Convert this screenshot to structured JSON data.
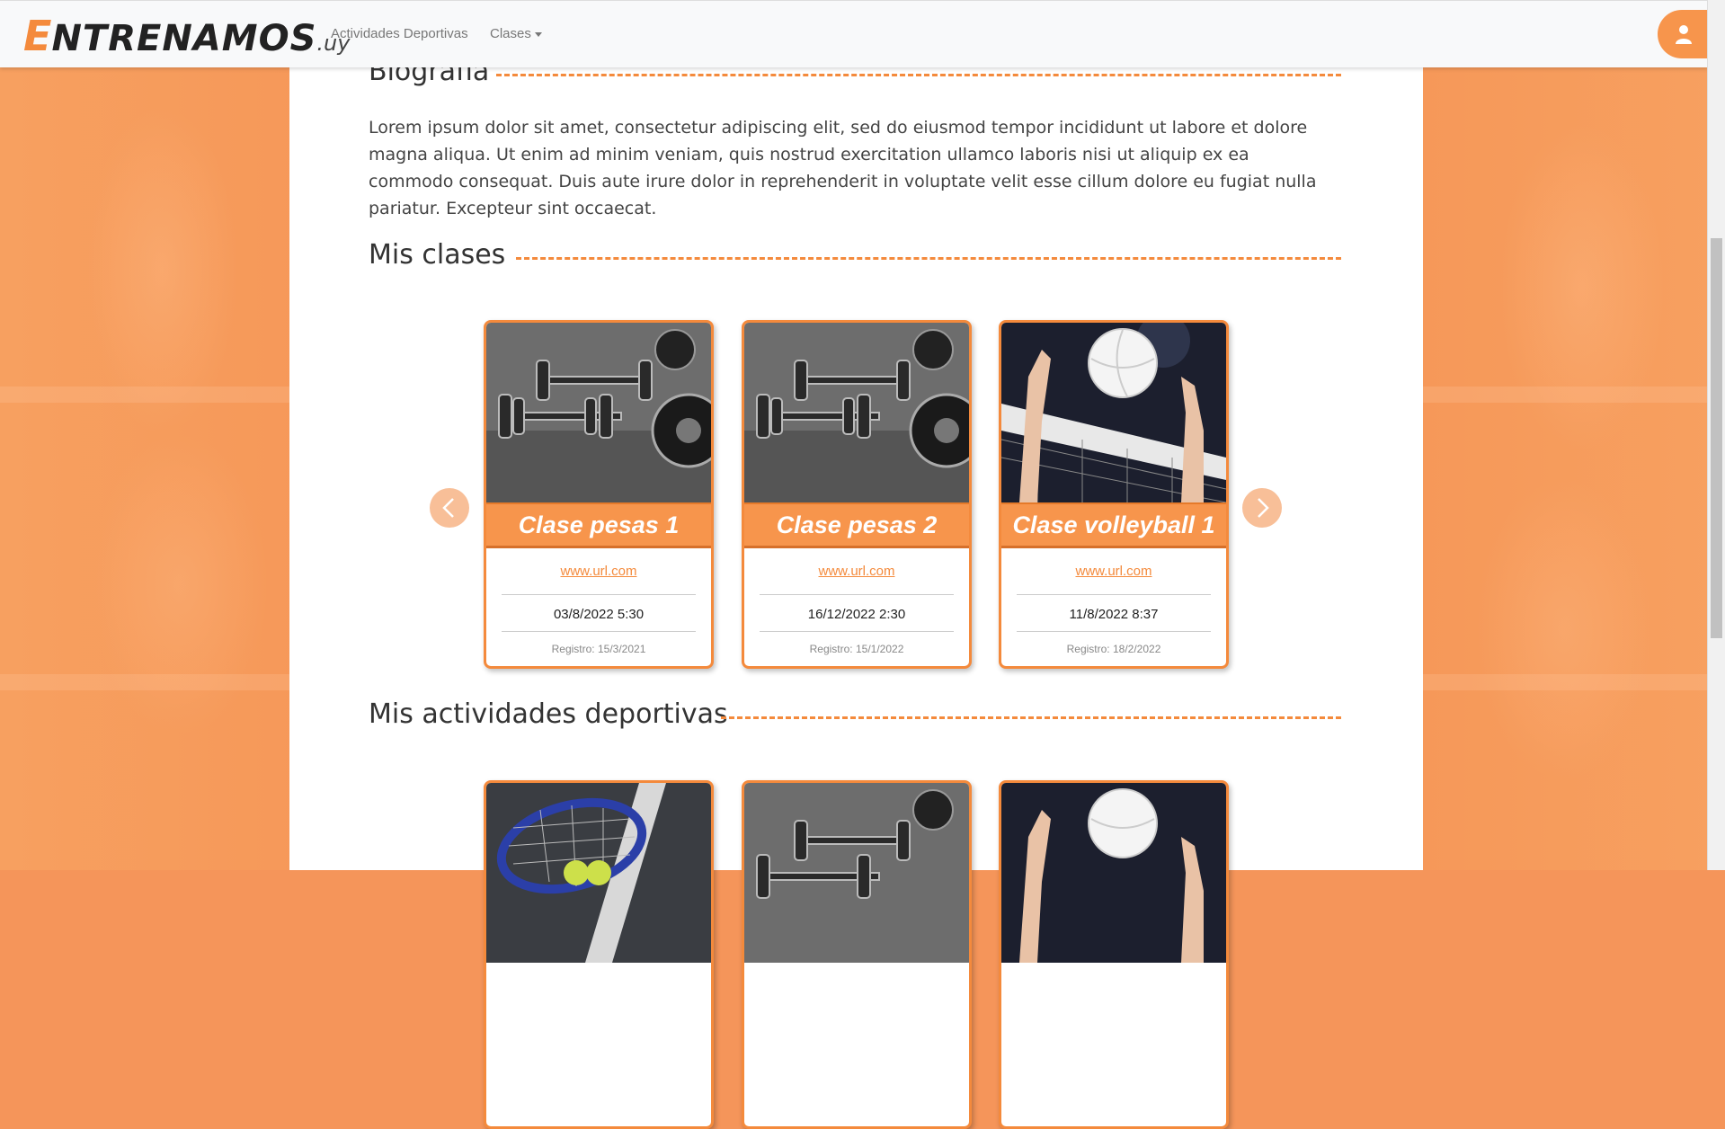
{
  "navbar": {
    "brand_e": "E",
    "brand_rest": "NTRENAMOS",
    "brand_uy": ".uy",
    "links": [
      {
        "label": "Actividades Deportivas"
      },
      {
        "label": "Clases"
      }
    ],
    "user_icon": "user-icon"
  },
  "biography": {
    "title": "Biografía",
    "text": "Lorem ipsum dolor sit amet, consectetur adipiscing elit, sed do eiusmod tempor incididunt ut labore et dolore magna aliqua. Ut enim ad minim veniam, quis nostrud exercitation ullamco laboris nisi ut aliquip ex ea commodo consequat. Duis aute irure dolor in reprehenderit in voluptate velit esse cillum dolore eu fugiat nulla pariatur. Excepteur sint occaecat."
  },
  "classes": {
    "title": "Mis clases",
    "items": [
      {
        "name": "Clase pesas 1",
        "url": "www.url.com",
        "date": "03/8/2022 5:30",
        "registro": "Registro: 15/3/2021",
        "image": "dumbbells"
      },
      {
        "name": "Clase pesas 2",
        "url": "www.url.com",
        "date": "16/12/2022 2:30",
        "registro": "Registro: 15/1/2022",
        "image": "dumbbells"
      },
      {
        "name": "Clase volleyball 1",
        "url": "www.url.com",
        "date": "11/8/2022 8:37",
        "registro": "Registro: 18/2/2022",
        "image": "volleyball"
      }
    ],
    "prev_icon": "chevron-left-icon",
    "next_icon": "chevron-right-icon"
  },
  "activities": {
    "title": "Mis actividades deportivas",
    "items": [
      {
        "image": "tennis"
      },
      {
        "image": "dumbbells"
      },
      {
        "image": "volleyball"
      }
    ]
  },
  "colors": {
    "accent": "#f48a3c",
    "background": "#f5955a"
  }
}
